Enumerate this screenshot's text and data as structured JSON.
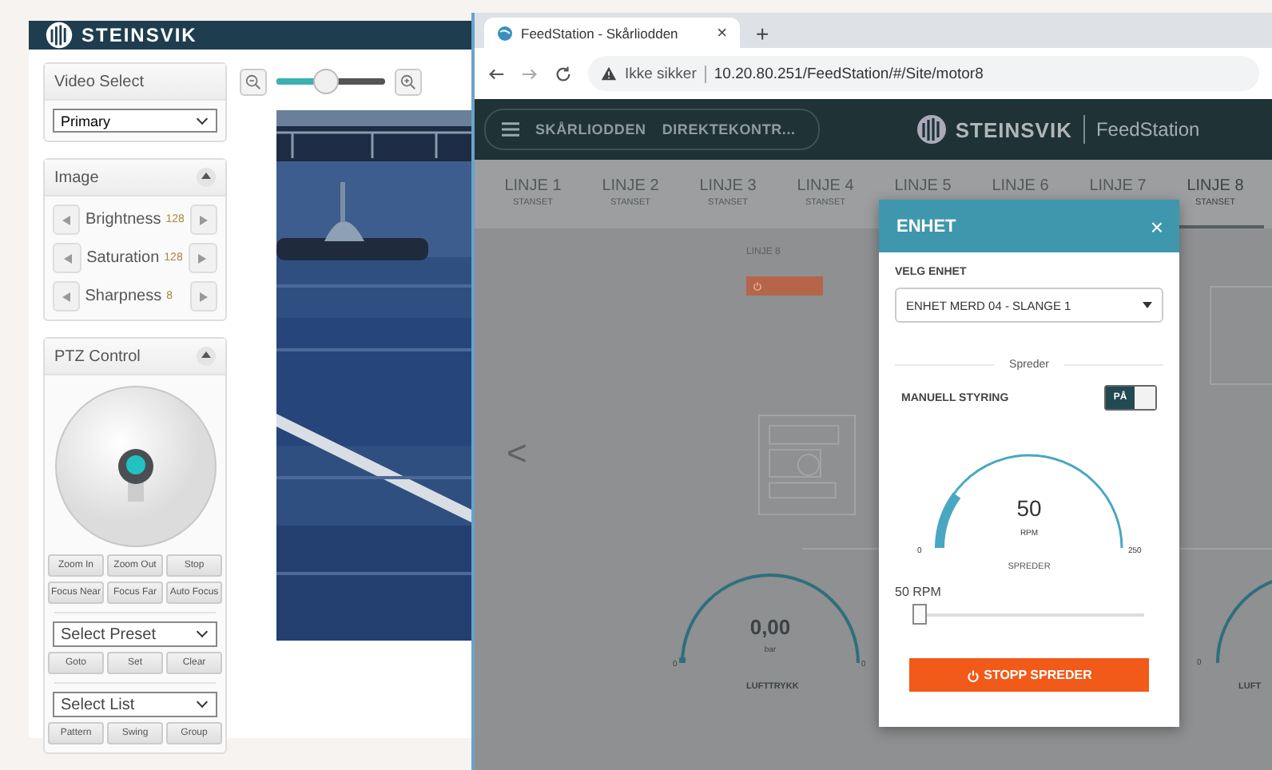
{
  "camera_app": {
    "brand": "STEINSVIK",
    "video_select": {
      "title": "Video Select",
      "value": "Primary"
    },
    "image": {
      "title": "Image",
      "adjustments": [
        {
          "label": "Brightness",
          "value": "128"
        },
        {
          "label": "Saturation",
          "value": "128"
        },
        {
          "label": "Sharpness",
          "value": "8"
        }
      ]
    },
    "ptz": {
      "title": "PTZ Control",
      "button_rows": [
        [
          "Zoom In",
          "Zoom Out",
          "Stop"
        ],
        [
          "Focus Near",
          "Focus Far",
          "Auto Focus"
        ]
      ],
      "preset_select": "Select Preset",
      "preset_buttons": [
        "Goto",
        "Set",
        "Clear"
      ],
      "list_select": "Select List",
      "list_buttons": [
        "Pattern",
        "Swing",
        "Group"
      ]
    },
    "zoom_slider": {
      "level": 0.45
    }
  },
  "browser": {
    "tab": {
      "title": "FeedStation - Skårliodden",
      "close": "×"
    },
    "new_tab": "+",
    "security": "Ikke sikker",
    "url": "10.20.80.251/FeedStation/#/Site/motor8"
  },
  "feedstation": {
    "breadcrumbs": [
      "SKÅRLIODDEN",
      "DIREKTEKONTR..."
    ],
    "brand": "STEINSVIK",
    "product": "FeedStation",
    "lines": [
      {
        "name": "LINJE 1",
        "status": "STANSET",
        "selected": false
      },
      {
        "name": "LINJE 2",
        "status": "STANSET",
        "selected": false
      },
      {
        "name": "LINJE 3",
        "status": "STANSET",
        "selected": false
      },
      {
        "name": "LINJE 4",
        "status": "STANSET",
        "selected": false
      },
      {
        "name": "LINJE 5",
        "selected": false
      },
      {
        "name": "LINJE 6",
        "selected": false
      },
      {
        "name": "LINJE 7",
        "selected": false
      },
      {
        "name": "LINJE 8",
        "status": "STANSET",
        "selected": true
      }
    ],
    "line_card": {
      "title": "LINJE 8"
    },
    "pressure_gauge": {
      "value": "0,00",
      "unit": "bar",
      "label": "LUFTTRYKK",
      "min": "0",
      "max": "0",
      "level": 0.02
    },
    "right_gauge": {
      "min": "0",
      "label": "LUFT"
    },
    "prev_arrow": "<"
  },
  "modal": {
    "title": "ENHET",
    "close": "×",
    "select_label": "VELG ENHET",
    "select_value": "ENHET MERD 04 - SLANGE 1",
    "section": "Spreder",
    "toggle_label": "MANUELL STYRING",
    "toggle": {
      "on": true,
      "on_text": "PÅ"
    },
    "gauge": {
      "value": "50",
      "unit": "RPM",
      "min": "0",
      "max": "250",
      "label": "SPREDER",
      "level": 0.2
    },
    "slider_label": "50 RPM",
    "slider": {
      "level": 0.02
    },
    "stop_button": "STOPP SPREDER"
  }
}
